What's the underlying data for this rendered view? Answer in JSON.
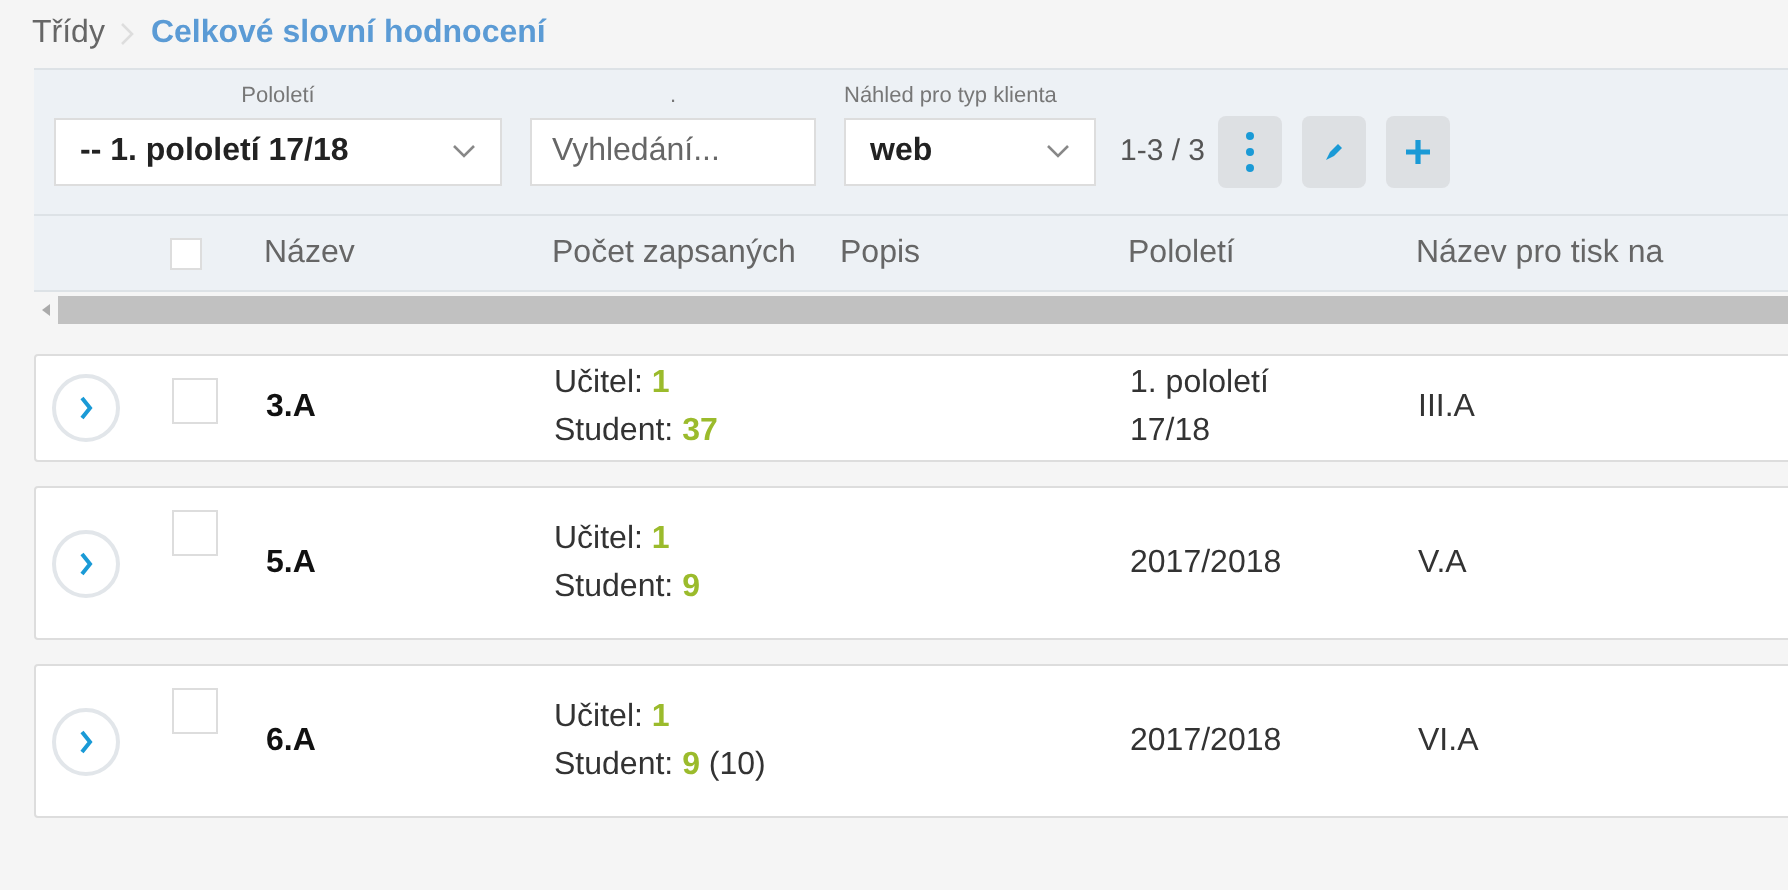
{
  "breadcrumb": {
    "parent": "Třídy",
    "current": "Celkové slovní hodnocení"
  },
  "filters": {
    "semester": {
      "label": "Pololetí",
      "value": "-- 1. pololetí 17/18"
    },
    "search": {
      "label": ".",
      "placeholder": "Vyhledání..."
    },
    "client": {
      "label": "Náhled pro typ klienta",
      "value": "web"
    },
    "count": "1-3 / 3"
  },
  "table": {
    "select_all": {
      "checked": false
    },
    "columns": [
      "Název",
      "Počet zapsaných",
      "Popis",
      "Pololetí",
      "Název pro tisk na"
    ],
    "rows": [
      {
        "checked": false,
        "name": "3.A",
        "counts": [
          {
            "label": "Učitel:",
            "value": "1"
          },
          {
            "label": "Student:",
            "value": "37"
          }
        ],
        "semester": "1. pololetí 17/18",
        "print_name": "III.A"
      },
      {
        "checked": false,
        "name": "5.A",
        "counts": [
          {
            "label": "Učitel:",
            "value": "1"
          },
          {
            "label": "Student:",
            "value": "9"
          }
        ],
        "semester": "2017/2018",
        "print_name": "V.A"
      },
      {
        "checked": false,
        "name": "6.A",
        "counts": [
          {
            "label": "Učitel:",
            "value": "1"
          },
          {
            "label": "Student:",
            "value": "9",
            "note": "(10)"
          }
        ],
        "semester": "2017/2018",
        "print_name": "VI.A"
      }
    ]
  }
}
